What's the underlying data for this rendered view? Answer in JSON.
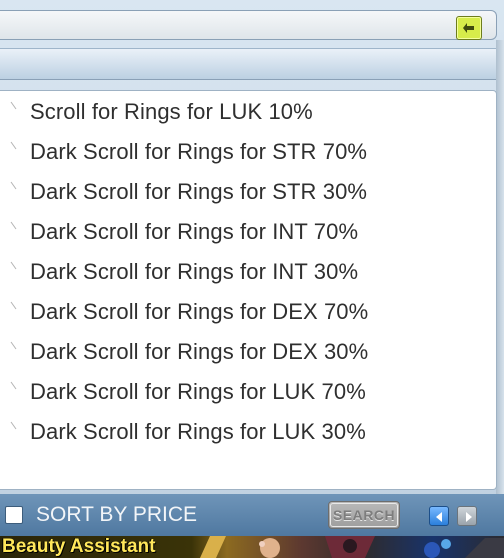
{
  "header": {
    "back_icon": "back-arrow-icon"
  },
  "items": [
    {
      "label": "Scroll for Rings for LUK 10%"
    },
    {
      "label": "Dark Scroll for Rings for STR 70%"
    },
    {
      "label": "Dark Scroll for Rings for STR 30%"
    },
    {
      "label": "Dark Scroll for Rings for INT 70%"
    },
    {
      "label": "Dark Scroll for Rings for INT 30%"
    },
    {
      "label": "Dark Scroll for Rings for DEX 70%"
    },
    {
      "label": "Dark Scroll for Rings for DEX 30%"
    },
    {
      "label": "Dark Scroll for Rings for LUK 70%"
    },
    {
      "label": "Dark Scroll for Rings for LUK 30%"
    }
  ],
  "bottom": {
    "sort_label": "SORT BY PRICE",
    "sort_checked": false,
    "search_label": "SEARCH",
    "prev_icon": "arrow-left-icon",
    "next_icon": "arrow-right-icon"
  },
  "footer": {
    "label": "Beauty Assistant"
  },
  "colors": {
    "list_text": "#2f2f2f",
    "bottom_bar": "#5d84ab",
    "back_button": "#d7ec4a",
    "footer_text": "#ffe75a"
  }
}
